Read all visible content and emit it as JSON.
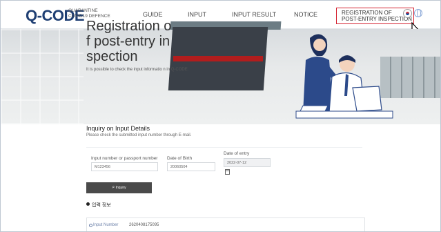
{
  "header": {
    "logo": "Q-CODE",
    "logo_sub_1": "QUARANTINE",
    "logo_sub_2": "COVID19 DEFENCE",
    "nav": [
      "GUIDE",
      "INPUT",
      "INPUT RESULT",
      "NOTICE"
    ],
    "nav_active_line1": "REGISTRATION OF",
    "nav_active_line2": "POST-ENTRY INSPECTION"
  },
  "hero": {
    "title_line1": "Registration o",
    "title_line2": "f post-entry in",
    "title_line3": "spection",
    "desc": "It is possible to check the input informatio n in Q-CODE."
  },
  "inquiry": {
    "title": "Inquiry on Input Details",
    "desc": "Please check the submitted input number through E-mail.",
    "field1_label": "Input number or passport number",
    "field1_value": "M123456",
    "field2_label": "Date of Birth",
    "field2_value": "20060504",
    "field3_label": "Date of entry",
    "field3_value": "2022-07-12",
    "button_label": "Inquiry"
  },
  "info": {
    "heading": "입력 정보",
    "result_label": "Input Number",
    "result_value": "2620408175095"
  },
  "colors": {
    "logo": "#1f3f73",
    "highlight_border": "#d41f2e",
    "button": "#4a4a4a"
  }
}
